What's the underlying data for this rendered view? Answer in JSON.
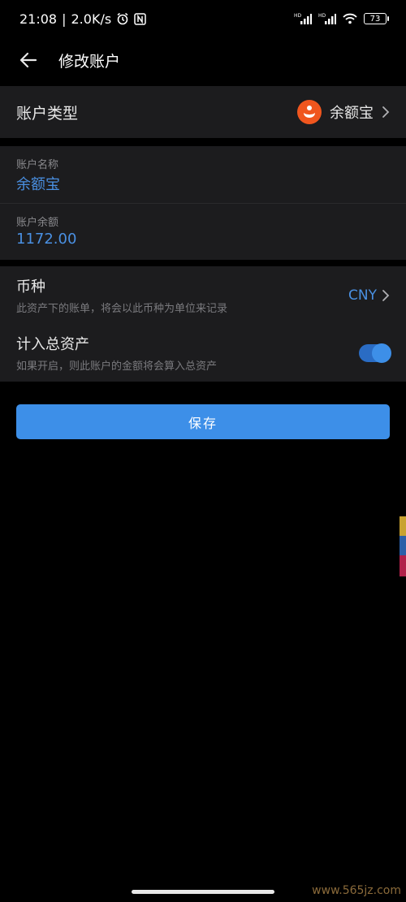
{
  "status_bar": {
    "time": "21:08",
    "speed": "2.0K/s",
    "battery": "73",
    "icons": [
      "alarm-icon",
      "nfc-icon",
      "signal-hd-icon",
      "signal-hd-icon",
      "wifi-icon",
      "battery-icon"
    ]
  },
  "header": {
    "title": "修改账户",
    "back_icon": "arrow-left-icon"
  },
  "account_type": {
    "label": "账户类型",
    "value": "余额宝",
    "icon": "yuebao-logo-icon",
    "icon_color": "#f0561e"
  },
  "account_name": {
    "label": "账户名称",
    "value": "余额宝"
  },
  "account_balance": {
    "label": "账户余额",
    "value": "1172.00"
  },
  "currency": {
    "title": "币种",
    "description": "此资产下的账单，将会以此币种为单位来记录",
    "value": "CNY"
  },
  "include_total": {
    "title": "计入总资产",
    "description": "如果开启，则此账户的金额将会算入总资产",
    "enabled": true
  },
  "save_button": {
    "label": "保存"
  },
  "watermark": "www.565jz.com",
  "colors": {
    "background": "#000000",
    "card": "#1c1c1e",
    "accent": "#3d8fe8",
    "link_text": "#4a90e2"
  }
}
